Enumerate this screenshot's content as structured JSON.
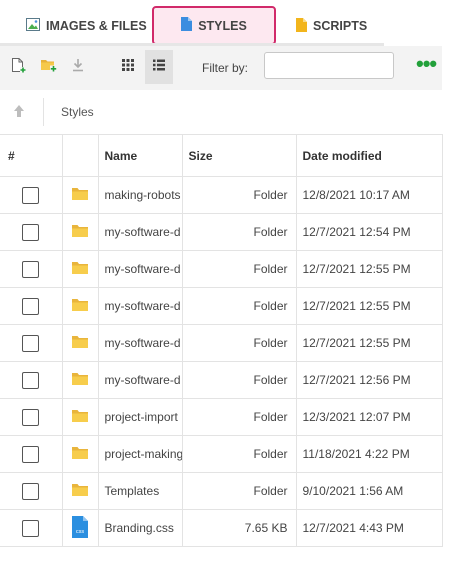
{
  "tabs": [
    {
      "label": "IMAGES & FILES",
      "icon": "image-icon",
      "active": false
    },
    {
      "label": "STYLES",
      "icon": "file-icon",
      "active": true
    },
    {
      "label": "SCRIPTS",
      "icon": "file-icon",
      "active": false
    }
  ],
  "toolbar": {
    "filter_label": "Filter by:",
    "filter_value": "",
    "filter_placeholder": "",
    "accent_color": "#22a03a",
    "more_label": "•••"
  },
  "breadcrumb": {
    "current": "Styles"
  },
  "table": {
    "columns": {
      "num": "#",
      "name": "Name",
      "size": "Size",
      "date": "Date modified"
    },
    "rows": [
      {
        "type": "folder",
        "name": "making-robots",
        "size": "Folder",
        "date": "12/8/2021 10:17 AM"
      },
      {
        "type": "folder",
        "name": "my-software-d",
        "size": "Folder",
        "date": "12/7/2021 12:54 PM"
      },
      {
        "type": "folder",
        "name": "my-software-d",
        "size": "Folder",
        "date": "12/7/2021 12:55 PM"
      },
      {
        "type": "folder",
        "name": "my-software-d",
        "size": "Folder",
        "date": "12/7/2021 12:55 PM"
      },
      {
        "type": "folder",
        "name": "my-software-d",
        "size": "Folder",
        "date": "12/7/2021 12:55 PM"
      },
      {
        "type": "folder",
        "name": "my-software-d",
        "size": "Folder",
        "date": "12/7/2021 12:56 PM"
      },
      {
        "type": "folder",
        "name": "project-import",
        "size": "Folder",
        "date": "12/3/2021 12:07 PM"
      },
      {
        "type": "folder",
        "name": "project-making",
        "size": "Folder",
        "date": "11/18/2021 4:22 PM"
      },
      {
        "type": "folder",
        "name": "Templates",
        "size": "Folder",
        "date": "9/10/2021 1:56 AM"
      },
      {
        "type": "css",
        "icon_label": "css",
        "name": "Branding.css",
        "size": "7.65 KB",
        "date": "12/7/2021 4:43 PM"
      }
    ]
  }
}
